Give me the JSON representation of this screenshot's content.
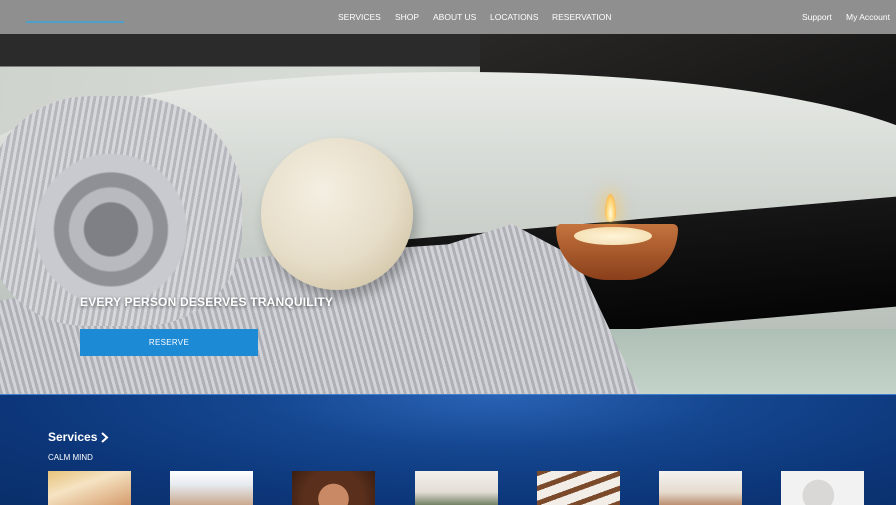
{
  "header": {
    "logo_text": "SANCTUARY",
    "nav": {
      "services": "SERVICES",
      "shop": "SHOP",
      "about": "ABOUT US",
      "locations": "LOCATIONS",
      "reservation": "RESERVATION"
    },
    "utility": {
      "support": "Support",
      "account": "My Account"
    }
  },
  "hero": {
    "title": "EVERY PERSON DESERVES TRANQUILITY",
    "button_label": "RESERVE"
  },
  "services": {
    "heading": "Services",
    "subheading": "CALM MIND",
    "thumbnails": [
      {
        "name": "service-thumbnail-1"
      },
      {
        "name": "service-thumbnail-2"
      },
      {
        "name": "service-thumbnail-3"
      },
      {
        "name": "service-thumbnail-4"
      },
      {
        "name": "service-thumbnail-5"
      },
      {
        "name": "service-thumbnail-6"
      },
      {
        "name": "service-thumbnail-7"
      }
    ]
  },
  "colors": {
    "header_bg": "#8f8f8f",
    "brand_blue": "#2ea6e6",
    "button_blue": "#1d8ad6",
    "section_blue": "#0c3679"
  }
}
